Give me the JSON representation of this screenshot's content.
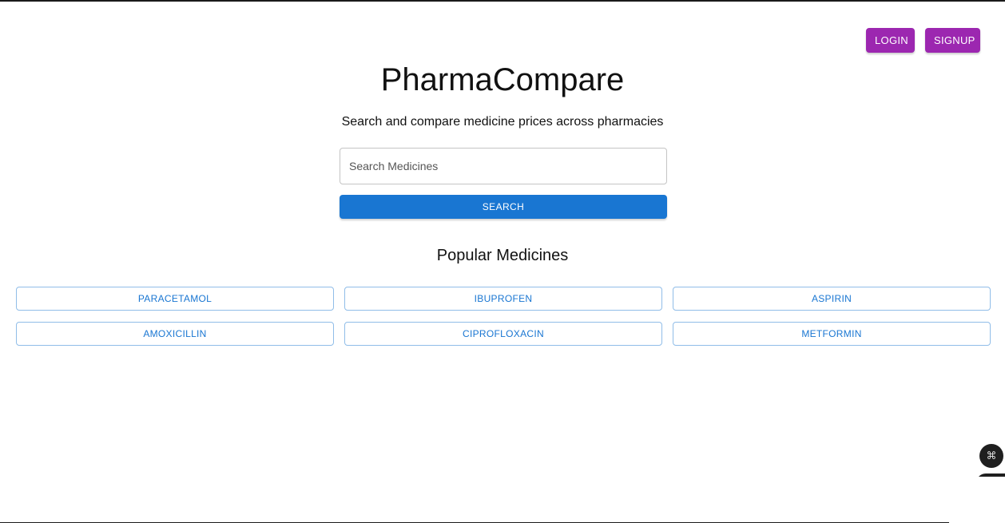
{
  "header": {
    "login_label": "LOGIN",
    "signup_label": "SIGNUP"
  },
  "hero": {
    "title": "PharmaCompare",
    "subtitle": "Search and compare medicine prices across pharmacies"
  },
  "search": {
    "placeholder": "Search Medicines",
    "value": "",
    "button_label": "SEARCH"
  },
  "popular": {
    "title": "Popular Medicines",
    "items": [
      {
        "label": "PARACETAMOL"
      },
      {
        "label": "IBUPROFEN"
      },
      {
        "label": "ASPIRIN"
      },
      {
        "label": "AMOXICILLIN"
      },
      {
        "label": "CIPROFLOXACIN"
      },
      {
        "label": "METFORMIN"
      }
    ]
  },
  "floating": {
    "icon": "command-icon",
    "glyph": "⌘"
  },
  "colors": {
    "auth_button": "#9c27b0",
    "primary": "#1976d2",
    "outline": "#90bde8"
  }
}
